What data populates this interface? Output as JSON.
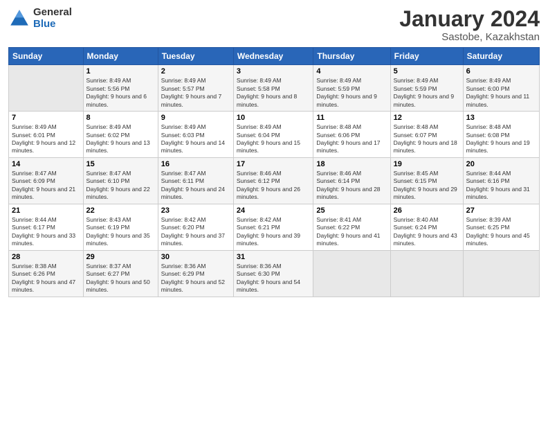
{
  "header": {
    "logo_general": "General",
    "logo_blue": "Blue",
    "month_title": "January 2024",
    "location": "Sastobe, Kazakhstan"
  },
  "weekdays": [
    "Sunday",
    "Monday",
    "Tuesday",
    "Wednesday",
    "Thursday",
    "Friday",
    "Saturday"
  ],
  "weeks": [
    [
      {
        "day": "",
        "sunrise": "",
        "sunset": "",
        "daylight": "",
        "empty": true
      },
      {
        "day": "1",
        "sunrise": "Sunrise: 8:49 AM",
        "sunset": "Sunset: 5:56 PM",
        "daylight": "Daylight: 9 hours and 6 minutes."
      },
      {
        "day": "2",
        "sunrise": "Sunrise: 8:49 AM",
        "sunset": "Sunset: 5:57 PM",
        "daylight": "Daylight: 9 hours and 7 minutes."
      },
      {
        "day": "3",
        "sunrise": "Sunrise: 8:49 AM",
        "sunset": "Sunset: 5:58 PM",
        "daylight": "Daylight: 9 hours and 8 minutes."
      },
      {
        "day": "4",
        "sunrise": "Sunrise: 8:49 AM",
        "sunset": "Sunset: 5:59 PM",
        "daylight": "Daylight: 9 hours and 9 minutes."
      },
      {
        "day": "5",
        "sunrise": "Sunrise: 8:49 AM",
        "sunset": "Sunset: 5:59 PM",
        "daylight": "Daylight: 9 hours and 9 minutes."
      },
      {
        "day": "6",
        "sunrise": "Sunrise: 8:49 AM",
        "sunset": "Sunset: 6:00 PM",
        "daylight": "Daylight: 9 hours and 11 minutes."
      }
    ],
    [
      {
        "day": "7",
        "sunrise": "Sunrise: 8:49 AM",
        "sunset": "Sunset: 6:01 PM",
        "daylight": "Daylight: 9 hours and 12 minutes."
      },
      {
        "day": "8",
        "sunrise": "Sunrise: 8:49 AM",
        "sunset": "Sunset: 6:02 PM",
        "daylight": "Daylight: 9 hours and 13 minutes."
      },
      {
        "day": "9",
        "sunrise": "Sunrise: 8:49 AM",
        "sunset": "Sunset: 6:03 PM",
        "daylight": "Daylight: 9 hours and 14 minutes."
      },
      {
        "day": "10",
        "sunrise": "Sunrise: 8:49 AM",
        "sunset": "Sunset: 6:04 PM",
        "daylight": "Daylight: 9 hours and 15 minutes."
      },
      {
        "day": "11",
        "sunrise": "Sunrise: 8:48 AM",
        "sunset": "Sunset: 6:06 PM",
        "daylight": "Daylight: 9 hours and 17 minutes."
      },
      {
        "day": "12",
        "sunrise": "Sunrise: 8:48 AM",
        "sunset": "Sunset: 6:07 PM",
        "daylight": "Daylight: 9 hours and 18 minutes."
      },
      {
        "day": "13",
        "sunrise": "Sunrise: 8:48 AM",
        "sunset": "Sunset: 6:08 PM",
        "daylight": "Daylight: 9 hours and 19 minutes."
      }
    ],
    [
      {
        "day": "14",
        "sunrise": "Sunrise: 8:47 AM",
        "sunset": "Sunset: 6:09 PM",
        "daylight": "Daylight: 9 hours and 21 minutes."
      },
      {
        "day": "15",
        "sunrise": "Sunrise: 8:47 AM",
        "sunset": "Sunset: 6:10 PM",
        "daylight": "Daylight: 9 hours and 22 minutes."
      },
      {
        "day": "16",
        "sunrise": "Sunrise: 8:47 AM",
        "sunset": "Sunset: 6:11 PM",
        "daylight": "Daylight: 9 hours and 24 minutes."
      },
      {
        "day": "17",
        "sunrise": "Sunrise: 8:46 AM",
        "sunset": "Sunset: 6:12 PM",
        "daylight": "Daylight: 9 hours and 26 minutes."
      },
      {
        "day": "18",
        "sunrise": "Sunrise: 8:46 AM",
        "sunset": "Sunset: 6:14 PM",
        "daylight": "Daylight: 9 hours and 28 minutes."
      },
      {
        "day": "19",
        "sunrise": "Sunrise: 8:45 AM",
        "sunset": "Sunset: 6:15 PM",
        "daylight": "Daylight: 9 hours and 29 minutes."
      },
      {
        "day": "20",
        "sunrise": "Sunrise: 8:44 AM",
        "sunset": "Sunset: 6:16 PM",
        "daylight": "Daylight: 9 hours and 31 minutes."
      }
    ],
    [
      {
        "day": "21",
        "sunrise": "Sunrise: 8:44 AM",
        "sunset": "Sunset: 6:17 PM",
        "daylight": "Daylight: 9 hours and 33 minutes."
      },
      {
        "day": "22",
        "sunrise": "Sunrise: 8:43 AM",
        "sunset": "Sunset: 6:19 PM",
        "daylight": "Daylight: 9 hours and 35 minutes."
      },
      {
        "day": "23",
        "sunrise": "Sunrise: 8:42 AM",
        "sunset": "Sunset: 6:20 PM",
        "daylight": "Daylight: 9 hours and 37 minutes."
      },
      {
        "day": "24",
        "sunrise": "Sunrise: 8:42 AM",
        "sunset": "Sunset: 6:21 PM",
        "daylight": "Daylight: 9 hours and 39 minutes."
      },
      {
        "day": "25",
        "sunrise": "Sunrise: 8:41 AM",
        "sunset": "Sunset: 6:22 PM",
        "daylight": "Daylight: 9 hours and 41 minutes."
      },
      {
        "day": "26",
        "sunrise": "Sunrise: 8:40 AM",
        "sunset": "Sunset: 6:24 PM",
        "daylight": "Daylight: 9 hours and 43 minutes."
      },
      {
        "day": "27",
        "sunrise": "Sunrise: 8:39 AM",
        "sunset": "Sunset: 6:25 PM",
        "daylight": "Daylight: 9 hours and 45 minutes."
      }
    ],
    [
      {
        "day": "28",
        "sunrise": "Sunrise: 8:38 AM",
        "sunset": "Sunset: 6:26 PM",
        "daylight": "Daylight: 9 hours and 47 minutes."
      },
      {
        "day": "29",
        "sunrise": "Sunrise: 8:37 AM",
        "sunset": "Sunset: 6:27 PM",
        "daylight": "Daylight: 9 hours and 50 minutes."
      },
      {
        "day": "30",
        "sunrise": "Sunrise: 8:36 AM",
        "sunset": "Sunset: 6:29 PM",
        "daylight": "Daylight: 9 hours and 52 minutes."
      },
      {
        "day": "31",
        "sunrise": "Sunrise: 8:36 AM",
        "sunset": "Sunset: 6:30 PM",
        "daylight": "Daylight: 9 hours and 54 minutes."
      },
      {
        "day": "",
        "sunrise": "",
        "sunset": "",
        "daylight": "",
        "empty": true
      },
      {
        "day": "",
        "sunrise": "",
        "sunset": "",
        "daylight": "",
        "empty": true
      },
      {
        "day": "",
        "sunrise": "",
        "sunset": "",
        "daylight": "",
        "empty": true
      }
    ]
  ]
}
